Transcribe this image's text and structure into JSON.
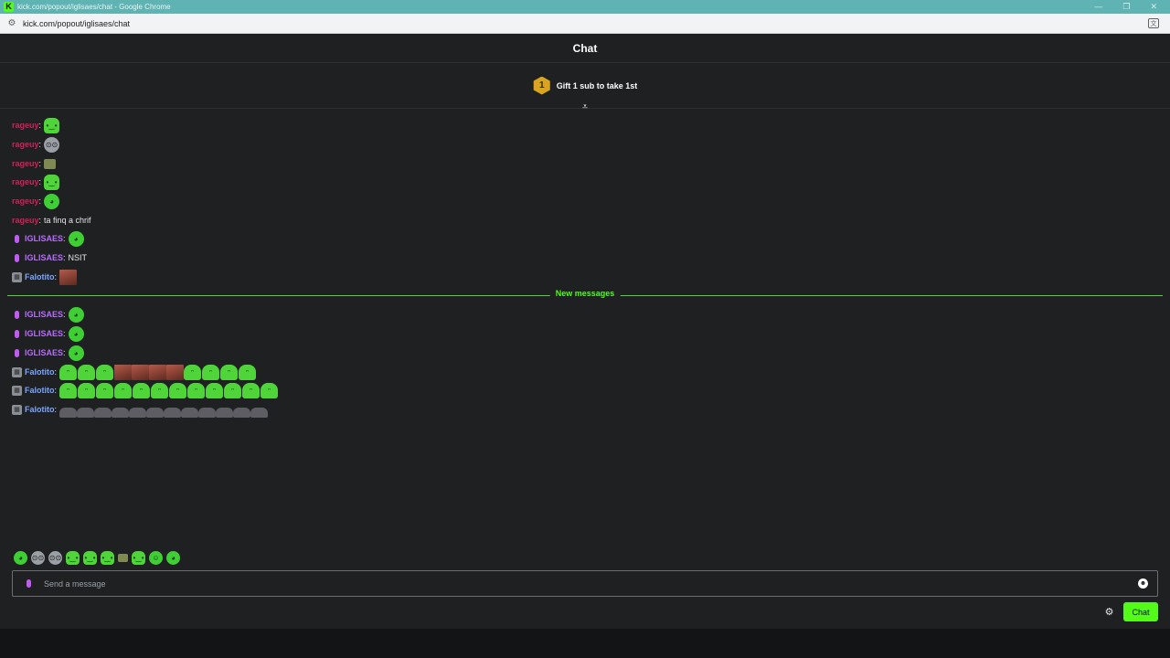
{
  "window": {
    "title": "kick.com/popout/iglisaes/chat - Google Chrome",
    "url": "kick.com/popout/iglisaes/chat"
  },
  "chat": {
    "header_title": "Chat",
    "gift_rank": "1",
    "gift_text": "Gift 1 sub to take 1st",
    "new_messages_label": "New messages",
    "input_placeholder": "Send a message",
    "send_label": "Chat"
  },
  "colors": {
    "accent": "#53fc18",
    "rageuy": "#d0215a",
    "iglisaes": "#b86bff",
    "falotito": "#7aa4ff"
  },
  "messages": [
    {
      "user": "rageuy",
      "text": "",
      "emotes": [
        "green-blob"
      ]
    },
    {
      "user": "rageuy",
      "text": "",
      "emotes": [
        "glasses-face"
      ]
    },
    {
      "user": "rageuy",
      "text": "",
      "emotes": [
        "box-face"
      ]
    },
    {
      "user": "rageuy",
      "text": "",
      "emotes": [
        "green-blob"
      ]
    },
    {
      "user": "rageuy",
      "text": "",
      "emotes": [
        "round-green"
      ]
    },
    {
      "user": "rageuy",
      "text": "ta finq a chrif",
      "emotes": []
    },
    {
      "user": "IGLISAES",
      "text": "",
      "emotes": [
        "round-green"
      ]
    },
    {
      "user": "IGLISAES",
      "text": "NSIT",
      "emotes": []
    },
    {
      "user": "Falotito",
      "text": "",
      "emotes": [
        "photo"
      ]
    },
    {
      "user": "IGLISAES",
      "text": "",
      "emotes": [
        "round-green"
      ]
    },
    {
      "user": "IGLISAES",
      "text": "",
      "emotes": [
        "round-green"
      ]
    },
    {
      "user": "IGLISAES",
      "text": "",
      "emotes": [
        "round-green"
      ]
    },
    {
      "user": "Falotito",
      "text": "",
      "emotes": [
        "ghost",
        "ghost",
        "ghost",
        "photo",
        "photo",
        "photo",
        "photo",
        "ghost",
        "ghost",
        "ghost",
        "ghost"
      ]
    },
    {
      "user": "Falotito",
      "text": "",
      "emotes": [
        "ghost",
        "ghost",
        "ghost",
        "ghost",
        "ghost",
        "ghost",
        "ghost",
        "ghost",
        "ghost",
        "ghost",
        "ghost",
        "ghost"
      ]
    },
    {
      "user": "Falotito",
      "text": "",
      "emotes": [
        "bird",
        "bird",
        "bird",
        "bird",
        "bird",
        "bird",
        "bird",
        "bird",
        "bird",
        "bird",
        "bird",
        "bird"
      ]
    }
  ],
  "quick_emotes": [
    "round-green",
    "glasses-face",
    "glasses-face",
    "green-blob",
    "green-blob",
    "green-blob",
    "box-face",
    "green-blob",
    "face-yellow",
    "round-green"
  ]
}
